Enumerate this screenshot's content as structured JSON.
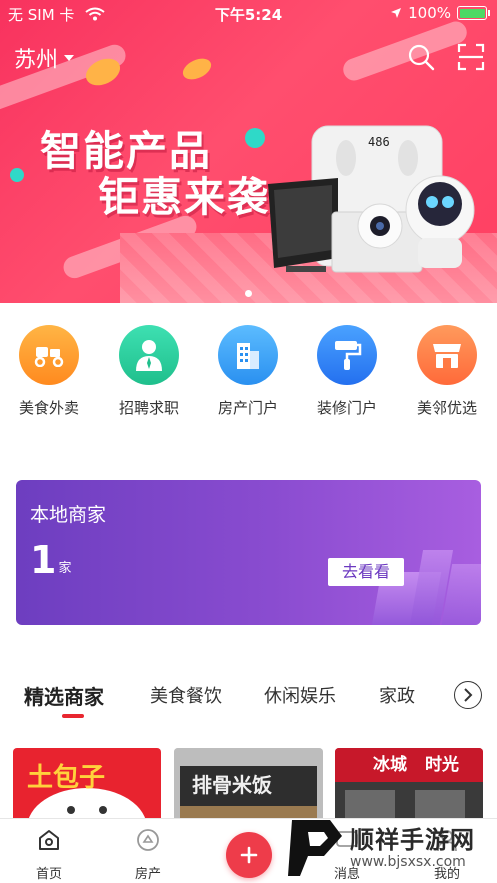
{
  "status_bar": {
    "carrier": "无 SIM 卡",
    "time": "下午5:24",
    "battery_text": "100%",
    "battery_level": 1.0
  },
  "header": {
    "city": "苏州",
    "icons": [
      "search-icon",
      "scan-icon"
    ]
  },
  "banner": {
    "line1": "智能产品",
    "line2": "钜惠来袭",
    "scale_display": "486",
    "page_count": 1,
    "active_page": 0
  },
  "categories": [
    {
      "label": "美食外卖",
      "icon": "food-delivery-icon",
      "color": "#ffa02a"
    },
    {
      "label": "招聘求职",
      "icon": "job-icon",
      "color": "#2fd1a0"
    },
    {
      "label": "房产门户",
      "icon": "building-icon",
      "color": "#3aa6ff"
    },
    {
      "label": "装修门户",
      "icon": "paint-roller-icon",
      "color": "#3a8cff"
    },
    {
      "label": "美邻优选",
      "icon": "shop-icon",
      "color": "#ff7a45"
    }
  ],
  "merchant_card": {
    "title": "本地商家",
    "count": "1",
    "unit": "家",
    "button": "去看看"
  },
  "tabs": {
    "items": [
      "精选商家",
      "美食餐饮",
      "休闲娱乐",
      "家政"
    ],
    "active": 0
  },
  "shops": [
    {
      "sign": "土包子"
    },
    {
      "sign": "排骨米饭"
    },
    {
      "sign": "冰城",
      "sign2": "时光"
    }
  ],
  "bottom_nav": {
    "items": [
      "首页",
      "房产",
      "消息",
      "我的"
    ],
    "active": 0
  },
  "watermark": {
    "title": "顺祥手游网",
    "url": "www.bjsxsx.com"
  },
  "colors": {
    "brand_red": "#f8325e",
    "accent_red": "#e8262f",
    "merchant_purple": "#7a45c8"
  }
}
